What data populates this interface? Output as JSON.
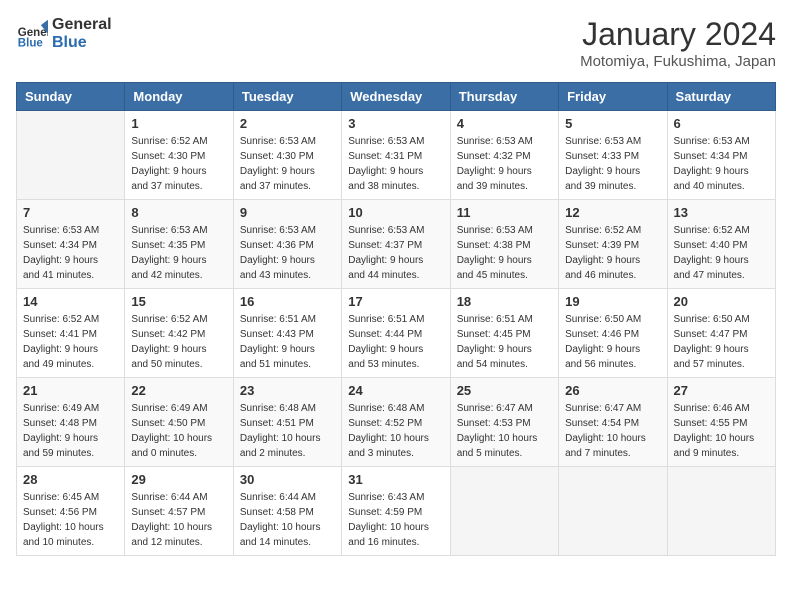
{
  "header": {
    "logo_general": "General",
    "logo_blue": "Blue",
    "title": "January 2024",
    "location": "Motomiya, Fukushima, Japan"
  },
  "weekdays": [
    "Sunday",
    "Monday",
    "Tuesday",
    "Wednesday",
    "Thursday",
    "Friday",
    "Saturday"
  ],
  "weeks": [
    [
      {
        "day": "",
        "info": ""
      },
      {
        "day": "1",
        "info": "Sunrise: 6:52 AM\nSunset: 4:30 PM\nDaylight: 9 hours\nand 37 minutes."
      },
      {
        "day": "2",
        "info": "Sunrise: 6:53 AM\nSunset: 4:30 PM\nDaylight: 9 hours\nand 37 minutes."
      },
      {
        "day": "3",
        "info": "Sunrise: 6:53 AM\nSunset: 4:31 PM\nDaylight: 9 hours\nand 38 minutes."
      },
      {
        "day": "4",
        "info": "Sunrise: 6:53 AM\nSunset: 4:32 PM\nDaylight: 9 hours\nand 39 minutes."
      },
      {
        "day": "5",
        "info": "Sunrise: 6:53 AM\nSunset: 4:33 PM\nDaylight: 9 hours\nand 39 minutes."
      },
      {
        "day": "6",
        "info": "Sunrise: 6:53 AM\nSunset: 4:34 PM\nDaylight: 9 hours\nand 40 minutes."
      }
    ],
    [
      {
        "day": "7",
        "info": "Sunrise: 6:53 AM\nSunset: 4:34 PM\nDaylight: 9 hours\nand 41 minutes."
      },
      {
        "day": "8",
        "info": "Sunrise: 6:53 AM\nSunset: 4:35 PM\nDaylight: 9 hours\nand 42 minutes."
      },
      {
        "day": "9",
        "info": "Sunrise: 6:53 AM\nSunset: 4:36 PM\nDaylight: 9 hours\nand 43 minutes."
      },
      {
        "day": "10",
        "info": "Sunrise: 6:53 AM\nSunset: 4:37 PM\nDaylight: 9 hours\nand 44 minutes."
      },
      {
        "day": "11",
        "info": "Sunrise: 6:53 AM\nSunset: 4:38 PM\nDaylight: 9 hours\nand 45 minutes."
      },
      {
        "day": "12",
        "info": "Sunrise: 6:52 AM\nSunset: 4:39 PM\nDaylight: 9 hours\nand 46 minutes."
      },
      {
        "day": "13",
        "info": "Sunrise: 6:52 AM\nSunset: 4:40 PM\nDaylight: 9 hours\nand 47 minutes."
      }
    ],
    [
      {
        "day": "14",
        "info": "Sunrise: 6:52 AM\nSunset: 4:41 PM\nDaylight: 9 hours\nand 49 minutes."
      },
      {
        "day": "15",
        "info": "Sunrise: 6:52 AM\nSunset: 4:42 PM\nDaylight: 9 hours\nand 50 minutes."
      },
      {
        "day": "16",
        "info": "Sunrise: 6:51 AM\nSunset: 4:43 PM\nDaylight: 9 hours\nand 51 minutes."
      },
      {
        "day": "17",
        "info": "Sunrise: 6:51 AM\nSunset: 4:44 PM\nDaylight: 9 hours\nand 53 minutes."
      },
      {
        "day": "18",
        "info": "Sunrise: 6:51 AM\nSunset: 4:45 PM\nDaylight: 9 hours\nand 54 minutes."
      },
      {
        "day": "19",
        "info": "Sunrise: 6:50 AM\nSunset: 4:46 PM\nDaylight: 9 hours\nand 56 minutes."
      },
      {
        "day": "20",
        "info": "Sunrise: 6:50 AM\nSunset: 4:47 PM\nDaylight: 9 hours\nand 57 minutes."
      }
    ],
    [
      {
        "day": "21",
        "info": "Sunrise: 6:49 AM\nSunset: 4:48 PM\nDaylight: 9 hours\nand 59 minutes."
      },
      {
        "day": "22",
        "info": "Sunrise: 6:49 AM\nSunset: 4:50 PM\nDaylight: 10 hours\nand 0 minutes."
      },
      {
        "day": "23",
        "info": "Sunrise: 6:48 AM\nSunset: 4:51 PM\nDaylight: 10 hours\nand 2 minutes."
      },
      {
        "day": "24",
        "info": "Sunrise: 6:48 AM\nSunset: 4:52 PM\nDaylight: 10 hours\nand 3 minutes."
      },
      {
        "day": "25",
        "info": "Sunrise: 6:47 AM\nSunset: 4:53 PM\nDaylight: 10 hours\nand 5 minutes."
      },
      {
        "day": "26",
        "info": "Sunrise: 6:47 AM\nSunset: 4:54 PM\nDaylight: 10 hours\nand 7 minutes."
      },
      {
        "day": "27",
        "info": "Sunrise: 6:46 AM\nSunset: 4:55 PM\nDaylight: 10 hours\nand 9 minutes."
      }
    ],
    [
      {
        "day": "28",
        "info": "Sunrise: 6:45 AM\nSunset: 4:56 PM\nDaylight: 10 hours\nand 10 minutes."
      },
      {
        "day": "29",
        "info": "Sunrise: 6:44 AM\nSunset: 4:57 PM\nDaylight: 10 hours\nand 12 minutes."
      },
      {
        "day": "30",
        "info": "Sunrise: 6:44 AM\nSunset: 4:58 PM\nDaylight: 10 hours\nand 14 minutes."
      },
      {
        "day": "31",
        "info": "Sunrise: 6:43 AM\nSunset: 4:59 PM\nDaylight: 10 hours\nand 16 minutes."
      },
      {
        "day": "",
        "info": ""
      },
      {
        "day": "",
        "info": ""
      },
      {
        "day": "",
        "info": ""
      }
    ]
  ]
}
